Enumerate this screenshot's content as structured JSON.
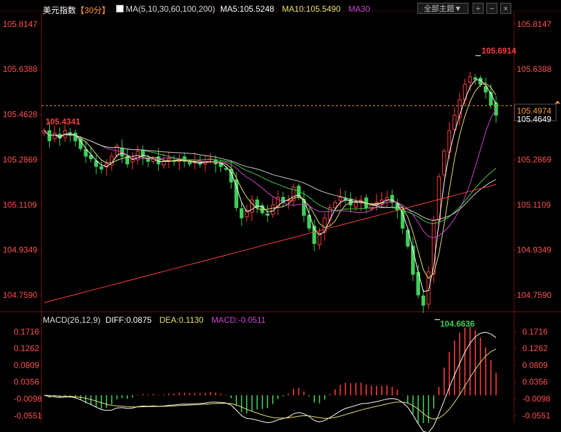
{
  "header": {
    "title": "美元指数",
    "period": "【30分】",
    "ma_label": "MA(5,10,30,60,100,200)",
    "ma5": "MA5:105.5248",
    "ma10": "MA10:105.5490",
    "ma30": "MA30",
    "theme_button": "全部主题▼",
    "macd_label": "MACD(26,12,9)",
    "diff": "DIFF:0.0875",
    "dea": "DEA:0.1130",
    "macd_val": "MACD:-0.0511"
  },
  "colors": {
    "up": "#ff3c3c",
    "down": "#3fcf5a",
    "ma5": "#ffffff",
    "ma10": "#e8e070",
    "ma30": "#cc44cc",
    "ma60": "#44cc44",
    "ma100": "#cccccc",
    "ma200": "#ff4040",
    "axis_text": "#ff5050",
    "grid": "#7a1010"
  },
  "chart_data": [
    {
      "type": "candlestick",
      "title": "美元指数 【30分】",
      "y_ticks": [
        "105.8147",
        "105.6388",
        "105.4628",
        "105.2869",
        "105.1109",
        "104.9349",
        "104.7590"
      ],
      "ylim": [
        104.7,
        105.86
      ],
      "current_price": "105.4974",
      "last_close": "105.4649",
      "annotations": [
        {
          "text": "105.6914",
          "value": 105.6914,
          "kind": "high"
        },
        {
          "text": "105.4341",
          "value": 105.4341,
          "kind": "left-high"
        },
        {
          "text": "104.6636",
          "value": 104.6636,
          "kind": "low"
        }
      ],
      "ma_series": [
        {
          "name": "MA5",
          "value": "105.5248"
        },
        {
          "name": "MA10",
          "value": "105.5490"
        },
        {
          "name": "MA30",
          "value": ""
        }
      ],
      "close_series": [
        105.4,
        105.36,
        105.39,
        105.37,
        105.4,
        105.39,
        105.36,
        105.33,
        105.3,
        105.29,
        105.26,
        105.25,
        105.27,
        105.3,
        105.34,
        105.3,
        105.27,
        105.29,
        105.32,
        105.3,
        105.28,
        105.29,
        105.27,
        105.28,
        105.29,
        105.28,
        105.29,
        105.28,
        105.27,
        105.28,
        105.27,
        105.28,
        105.29,
        105.27,
        105.26,
        105.25,
        105.2,
        105.1,
        105.06,
        105.09,
        105.13,
        105.1,
        105.08,
        105.07,
        105.11,
        105.14,
        105.12,
        105.13,
        105.18,
        105.14,
        105.07,
        105.02,
        104.96,
        105.0,
        105.06,
        105.1,
        105.12,
        105.14,
        105.13,
        105.11,
        105.12,
        105.13,
        105.1,
        105.11,
        105.12,
        105.13,
        105.14,
        105.12,
        105.09,
        105.02,
        104.95,
        104.84,
        104.76,
        104.72,
        104.85,
        105.05,
        105.22,
        105.32,
        105.4,
        105.46,
        105.52,
        105.58,
        105.61,
        105.6,
        105.58,
        105.55,
        105.5,
        105.46
      ],
      "macd": {
        "y_ticks": [
          "0.1716",
          "0.1262",
          "0.0809",
          "0.0356",
          "-0.0098",
          "-0.0551"
        ],
        "ylim": [
          -0.075,
          0.19
        ],
        "diff": "0.0875",
        "dea": "0.1130",
        "macd": "-0.0511"
      }
    }
  ]
}
